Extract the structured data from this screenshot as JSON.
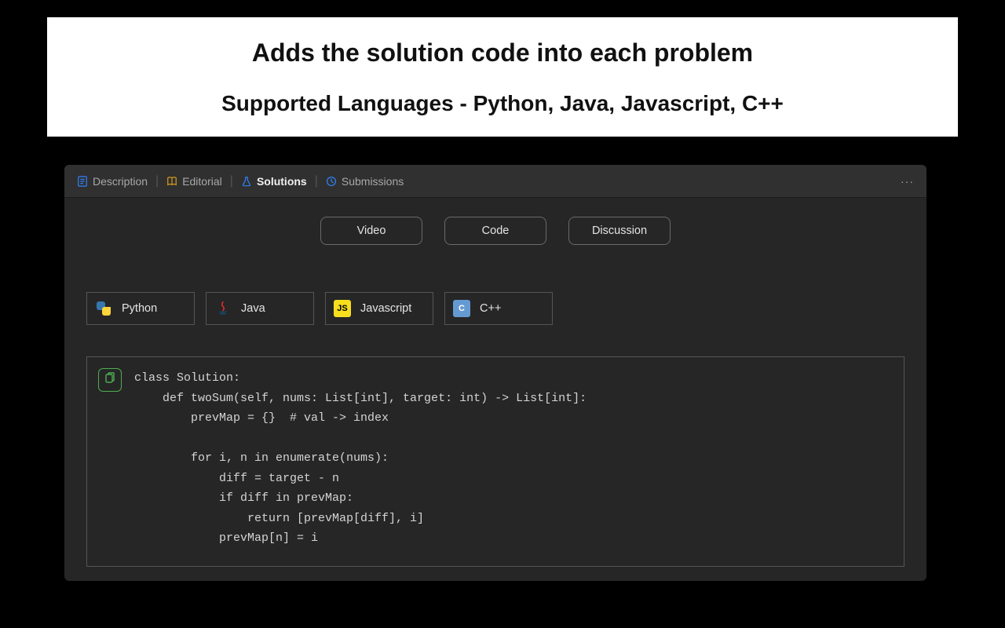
{
  "banner": {
    "title": "Adds the solution code into each problem",
    "subtitle": "Supported Languages - Python, Java, Javascript, C++"
  },
  "tabs": [
    {
      "label": "Description",
      "icon": "description-icon",
      "icon_color": "#2f81f7"
    },
    {
      "label": "Editorial",
      "icon": "book-icon",
      "icon_color": "#d29922"
    },
    {
      "label": "Solutions",
      "icon": "flask-icon",
      "icon_color": "#2f81f7",
      "active": true
    },
    {
      "label": "Submissions",
      "icon": "clock-icon",
      "icon_color": "#2f81f7"
    }
  ],
  "more_label": "···",
  "pills": [
    {
      "label": "Video"
    },
    {
      "label": "Code"
    },
    {
      "label": "Discussion"
    }
  ],
  "languages": [
    {
      "label": "Python",
      "icon": "python-icon"
    },
    {
      "label": "Java",
      "icon": "java-icon"
    },
    {
      "label": "Javascript",
      "icon": "javascript-icon"
    },
    {
      "label": "C++",
      "icon": "cpp-icon"
    }
  ],
  "code": "class Solution:\n    def twoSum(self, nums: List[int], target: int) -> List[int]:\n        prevMap = {}  # val -> index\n\n        for i, n in enumerate(nums):\n            diff = target - n\n            if diff in prevMap:\n                return [prevMap[diff], i]\n            prevMap[n] = i"
}
